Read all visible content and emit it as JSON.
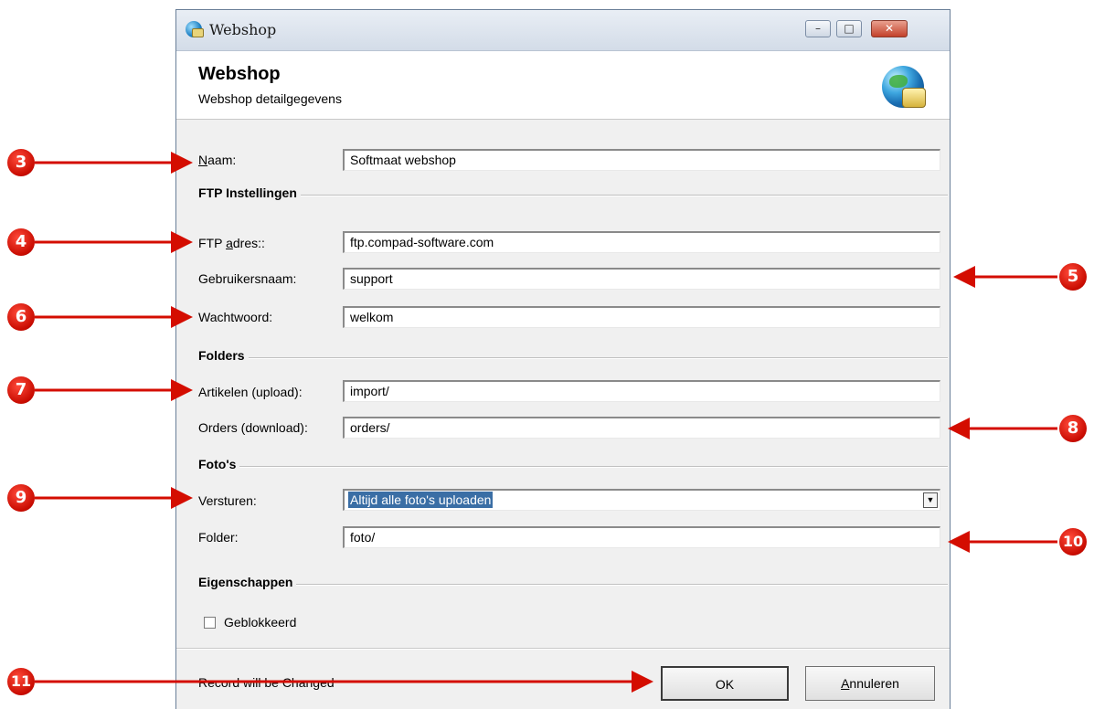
{
  "window": {
    "title": "Webshop",
    "header_title": "Webshop",
    "header_subtitle": "Webshop detailgegevens",
    "minimize_symbol": "–",
    "maximize_symbol": "□",
    "close_symbol": "✕"
  },
  "form": {
    "naam": {
      "label_accel": "N",
      "label_rest": "aam:",
      "value": "Softmaat webshop"
    },
    "ftp_section": "FTP Instellingen",
    "ftp_adres": {
      "label_pre": "FTP ",
      "label_accel": "a",
      "label_rest": "dres::",
      "value": "ftp.compad-software.com"
    },
    "gebruikersnaam": {
      "label": "Gebruikersnaam:",
      "value": "support"
    },
    "wachtwoord": {
      "label": "Wachtwoord:",
      "value": "welkom"
    },
    "folders_section": "Folders",
    "artikelen": {
      "label": "Artikelen (upload):",
      "value": "import/"
    },
    "orders": {
      "label": "Orders (download):",
      "value": "orders/"
    },
    "fotos_section": "Foto's",
    "versturen": {
      "label": "Versturen:",
      "value": "Altijd alle foto's uploaden"
    },
    "folder": {
      "label": "Folder:",
      "value": "foto/"
    },
    "eigenschappen_section": "Eigenschappen",
    "geblokkeerd": {
      "label": "Geblokkeerd",
      "checked": false
    }
  },
  "footer": {
    "status": "Record will be Changed",
    "ok_label": "OK",
    "cancel_accel": "A",
    "cancel_rest": "nnuleren"
  },
  "annotations": [
    "3",
    "4",
    "5",
    "6",
    "7",
    "8",
    "9",
    "10",
    "11"
  ],
  "colors": {
    "annotation": "#d40d00",
    "selection": "#3a6ea5"
  }
}
